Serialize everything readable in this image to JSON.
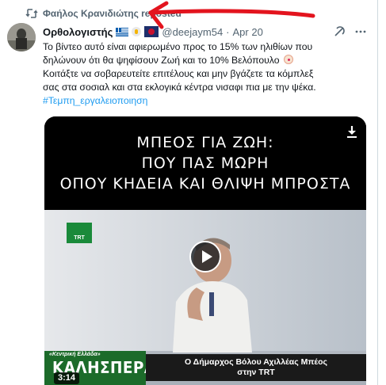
{
  "repost": {
    "icon": "repost-icon",
    "text": "Φαήλος Κρανιδιώτης reposted"
  },
  "annotation": {
    "icon": "red-arrow-icon",
    "color": "#e3141e"
  },
  "tweet": {
    "author_name": "Ορθολογιστής",
    "handle": "@deejaym54",
    "separator": "·",
    "date": "Apr 20",
    "text_line1": "Το βίντεο αυτό είναι αφιερωμένο προς το 15% των ηλιθίων που",
    "text_line2": "δηλώνουν ότι θα ψηφίσουν Ζωή και το 10% Βελόπουλο",
    "text_line3": "Κοιτάξτε να σοβαρευτείτε επιτέλους και μην βγάζετε τα κόμπλεξ",
    "text_line4": "σας στα σοσιαλ και στα εκλογικά κέντρα νισαφι πια με την ψέκα.",
    "hashtag": "#Τεμπη_εργαλειοποιηση",
    "icons": [
      "greek-flag-icon",
      "verified-badge-icon",
      "emblem-icon",
      "grok-icon",
      "more-icon",
      "clown-emoji-icon"
    ]
  },
  "video": {
    "caption_line1": "ΜΠΕΟΣ ΓΙΑ ΖΩΗ:",
    "caption_line2": "ΠΟΥ ΠΑΣ ΜΩΡΗ",
    "caption_line3": "ΟΠΟΥ ΚΗΔΕΙΑ ΚΑΙ ΘΛΙΨΗ ΜΠΡΟΣΤΑ",
    "channel_logo": "TRT",
    "region_label": "«Κεντρική Ελλάδα»",
    "show_name": "ΚΑΛΗΣΠΕΡΑ",
    "lower_third_line1": "Ο Δήμαρχος Βόλου Αχιλλέας Μπέος",
    "lower_third_line2": "στην TRT",
    "duration": "3:14",
    "icons": [
      "play-icon",
      "download-icon"
    ]
  }
}
